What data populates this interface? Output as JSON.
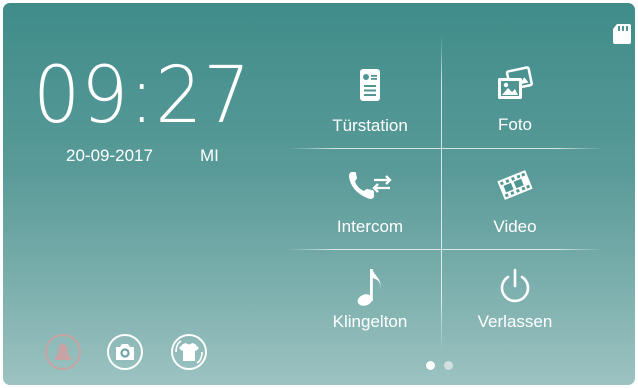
{
  "status": {
    "clock_time": "09:27",
    "date": "20-09-2017",
    "weekday": "MI"
  },
  "menu": {
    "items": [
      {
        "label": "Türstation",
        "icon": "door-station-icon"
      },
      {
        "label": "Foto",
        "icon": "photo-icon"
      },
      {
        "label": "Intercom",
        "icon": "intercom-icon"
      },
      {
        "label": "Video",
        "icon": "video-icon"
      },
      {
        "label": "Klingelton",
        "icon": "music-note-icon"
      },
      {
        "label": "Verlassen",
        "icon": "power-icon"
      }
    ]
  },
  "pager": {
    "pages": 2,
    "active_page": 1
  },
  "quick_actions": [
    {
      "icon": "alarm-bell-icon",
      "enabled": false
    },
    {
      "icon": "camera-icon",
      "enabled": true
    },
    {
      "icon": "cleaning-shirt-icon",
      "enabled": true
    }
  ],
  "indicators": {
    "sd_card": "sd-card-icon"
  },
  "colors": {
    "background_top": "#3f8c8a",
    "background_bottom": "#9cc3c1",
    "foreground": "#ffffff",
    "disabled": "#c9a3a3",
    "dot_inactive": "#cfe0df"
  }
}
